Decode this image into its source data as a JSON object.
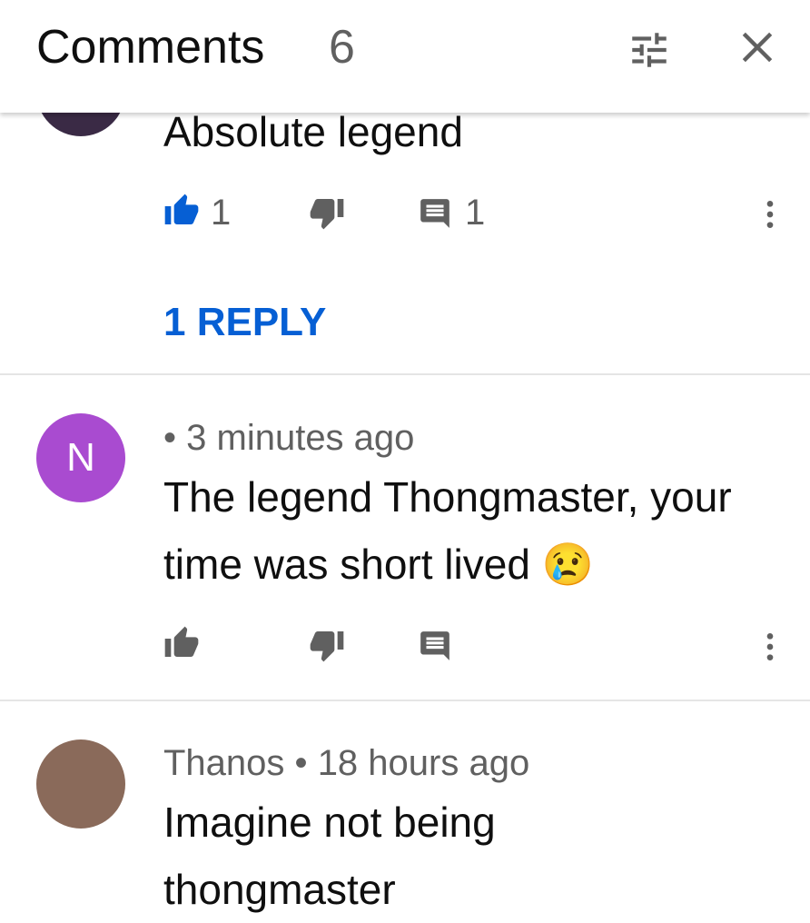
{
  "header": {
    "title": "Comments",
    "count": "6"
  },
  "comments": [
    {
      "text": "Absolute legend",
      "likes": "1",
      "replies": "1",
      "replies_link": "1 REPLY",
      "liked": true
    },
    {
      "avatar_letter": "N",
      "avatar_color": "#a94bd0",
      "separator": "•",
      "time": "3 minutes ago",
      "text": "The legend Thongmaster, your time was short lived 😢"
    },
    {
      "author": "Thanos",
      "separator": "•",
      "time": "18 hours ago",
      "text": "Imagine not being thongmaster"
    }
  ],
  "colors": {
    "accent": "#065fd4",
    "icon_gray": "#606060"
  }
}
